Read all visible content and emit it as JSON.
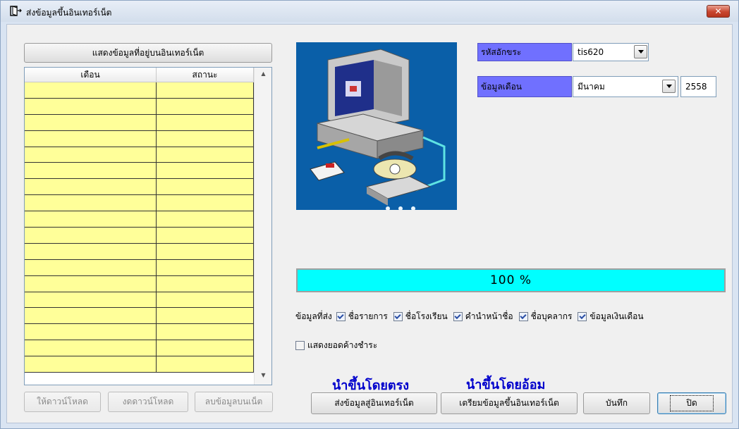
{
  "window": {
    "title": "ส่งข้อมูลขึ้นอินเทอร์เน็ต",
    "close_label": "✕"
  },
  "left": {
    "show_button": "แสดงข้อมูลที่อยู่บนอินเทอร์เน็ต",
    "columns": [
      "เดือน",
      "สถานะ"
    ],
    "rows": 18,
    "buttons": {
      "download": "ให้ดาวน์โหลด",
      "stop_download": "งดดาวน์โหลด",
      "delete": "ลบข้อมูลบนเน็ต"
    }
  },
  "settings": {
    "encoding_label": "รหัสอักขระ",
    "encoding_value": "tis620",
    "month_label": "ข้อมูลเดือน",
    "month_value": "มีนาคม",
    "year_value": "2558"
  },
  "progress": {
    "value": 100,
    "text": "100 %"
  },
  "data_send": {
    "label": "ข้อมูลที่ส่ง",
    "options": [
      {
        "label": "ชื่อรายการ",
        "checked": true
      },
      {
        "label": "ชื่อโรงเรียน",
        "checked": true
      },
      {
        "label": "คำนำหน้าชื่อ",
        "checked": true
      },
      {
        "label": "ชื่อบุคลากร",
        "checked": true
      },
      {
        "label": "ข้อมูลเงินเดือน",
        "checked": true
      }
    ]
  },
  "show_outstanding": {
    "label": "แสดงยอดค้างชำระ",
    "checked": false
  },
  "actions": {
    "direct_heading": "นำขึ้นโดยตรง",
    "indirect_heading": "นำขึ้นโดยอ้อม",
    "send": "ส่งข้อมูลสู่อินเทอร์เน็ต",
    "prepare": "เตรียมข้อมูลขึ้นอินเทอร์เน็ต",
    "save": "บันทึก",
    "close": "ปิด"
  },
  "colors": {
    "label_bg": "#7070ff",
    "grid_cell": "#ffff99",
    "progress": "#00ffff",
    "picture_bg": "#0a5fa8"
  }
}
